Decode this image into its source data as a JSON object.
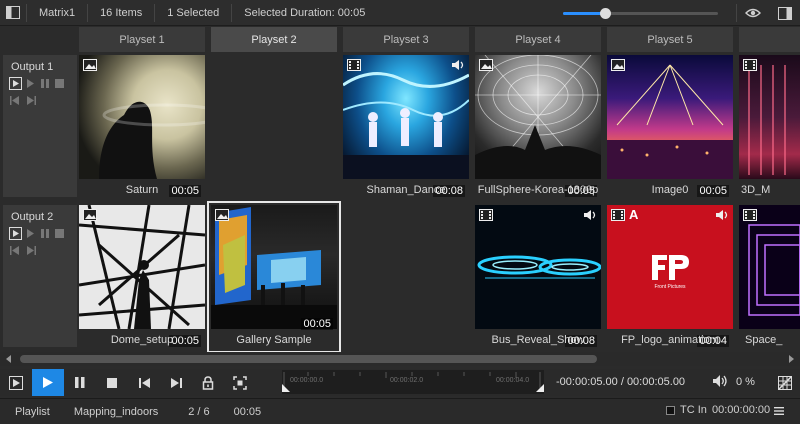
{
  "topbar": {
    "matrix_name": "Matrix1",
    "items_count": "16 Items",
    "selected_count": "1 Selected",
    "selected_duration": "Selected Duration: 00:05",
    "zoom_level": 0.27
  },
  "playsets": [
    "Playset 1",
    "Playset 2",
    "Playset 3",
    "Playset 4",
    "Playset 5",
    ""
  ],
  "outputs": [
    {
      "label": "Output 1"
    },
    {
      "label": "Output 2"
    }
  ],
  "row1": [
    {
      "label": "Saturn",
      "duration": "00:05",
      "type": "image",
      "audio": false
    },
    {
      "label": "",
      "duration": "",
      "type": "empty",
      "audio": false
    },
    {
      "label": "Shaman_Dance",
      "duration": "00:08",
      "type": "video",
      "audio": true
    },
    {
      "label": "FullSphere-Korea-1800p",
      "duration": "00:05",
      "type": "image",
      "audio": false
    },
    {
      "label": "Image0",
      "duration": "00:05",
      "type": "image",
      "audio": false
    },
    {
      "label": "3D_M",
      "duration": "",
      "type": "video",
      "audio": false
    }
  ],
  "row2": [
    {
      "label": "Dome_setup",
      "duration": "00:05",
      "type": "image",
      "audio": false
    },
    {
      "label": "Gallery Sample",
      "duration": "00:05",
      "type": "image",
      "audio": false
    },
    {
      "label": "",
      "duration": "",
      "type": "empty",
      "audio": false
    },
    {
      "label": "Bus_Reveal_Show",
      "duration": "00:08",
      "type": "video",
      "audio": true
    },
    {
      "label": "FP_logo_animatiom",
      "duration": "00:04",
      "type": "video",
      "audio": true,
      "a_badge": "A",
      "logo_text": "Front Pictures"
    },
    {
      "label": "Space_",
      "duration": "",
      "type": "video",
      "audio": false
    }
  ],
  "timeline": {
    "tick_start": "00:00:00.0",
    "tick_mid": "00:00:02.0",
    "tick_end": "00:00:04.0"
  },
  "transport": {
    "timecode": "-00:00:05.00 / 00:00:05.00",
    "volume": "0 %"
  },
  "status": {
    "mode": "Playlist",
    "project": "Mapping_indoors",
    "position": "2 / 6",
    "duration": "00:05",
    "tc_label": "TC In",
    "tc_value": "00:00:00:00"
  },
  "colors": {
    "accent": "#1e88e5",
    "panel": "#3a3a3a",
    "background": "#2b2b2b"
  }
}
